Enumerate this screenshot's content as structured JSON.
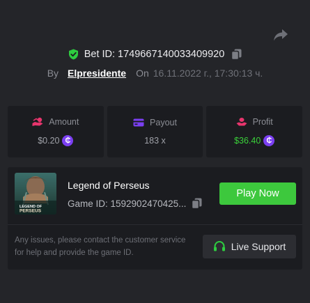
{
  "header": {
    "share_icon": "share-icon"
  },
  "bet": {
    "label": "Bet ID: 1749667140033409920",
    "verified_icon": "shield-check-icon",
    "copy_icon": "copy-icon"
  },
  "byline": {
    "by_label": "By",
    "username": "Elpresidente",
    "on_label": "On",
    "datetime": "16.11.2022 г., 17:30:13 ч."
  },
  "stats": {
    "amount": {
      "label": "Amount",
      "value": "$0.20",
      "icon": "hand-coins-icon",
      "icon_color": "#e8356d"
    },
    "payout": {
      "label": "Payout",
      "value": "183 x",
      "icon": "card-icon",
      "icon_color": "#7b3ff2"
    },
    "profit": {
      "label": "Profit",
      "value": "$36.40",
      "icon": "hand-stack-icon",
      "icon_color": "#e8356d",
      "value_color": "#3ad13a"
    },
    "currency_symbol": "₵"
  },
  "game": {
    "title": "Legend of Perseus",
    "game_id": "Game ID: 1592902470425...",
    "play_label": "Play Now",
    "thumb_caption_1": "LEGEND OF",
    "thumb_caption_2": "PERSEUS"
  },
  "support": {
    "text": "Any issues, please contact the customer service for help and provide the game ID.",
    "button_label": "Live Support",
    "icon": "headset-icon"
  },
  "colors": {
    "background": "#242529",
    "card": "#1b1c20",
    "accent_green": "#3dc83d",
    "accent_purple": "#7b3ff2",
    "accent_pink": "#e8356d"
  }
}
